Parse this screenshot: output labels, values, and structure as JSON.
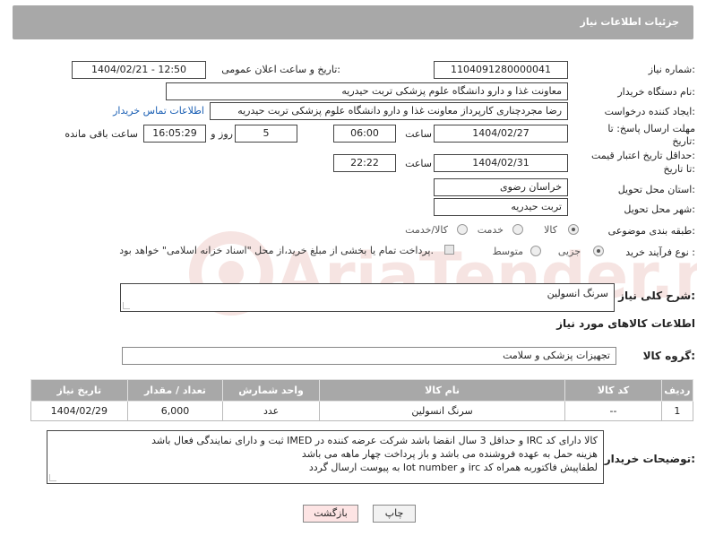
{
  "header": {
    "title": "جزئیات اطلاعات نیاز"
  },
  "form": {
    "need_number": {
      "label": "شماره نیاز:",
      "value": "1104091280000041"
    },
    "announce_datetime": {
      "label": "تاریخ و ساعت اعلان عمومی:",
      "value": "1404/02/21 - 12:50"
    },
    "buyer_org": {
      "label": "نام دستگاه خریدار:",
      "value": "معاونت غذا و دارو   دانشگاه علوم پزشکی تربت حیدریه"
    },
    "requester": {
      "label": "ایجاد کننده درخواست:",
      "value": "رضا مجردچناری کارپرداز معاونت غذا و دارو   دانشگاه علوم پزشکی تربت حیدریه",
      "contact_link": "اطلاعات تماس خریدار"
    },
    "reply_deadline": {
      "label_line1": "مهلت ارسال پاسخ: تا",
      "label_line2": "تاریخ:",
      "date": "1404/02/27",
      "time_label": "ساعت",
      "time": "06:00",
      "days": "5",
      "days_label": "روز و",
      "remaining": "16:05:29",
      "remaining_label": "ساعت باقی مانده"
    },
    "price_validity": {
      "label_line1": "حداقل تاریخ اعتبار قیمت:",
      "label_line2": "تا تاریخ:",
      "date": "1404/02/31",
      "time_label": "ساعت",
      "time": "22:22"
    },
    "delivery_province": {
      "label": "استان محل تحویل:",
      "value": "خراسان رضوی"
    },
    "delivery_city": {
      "label": "شهر محل تحویل:",
      "value": "تربت حیدریه"
    },
    "category": {
      "label": "طبقه بندی موضوعی:",
      "options": [
        "کالا",
        "خدمت",
        "کالا/خدمت"
      ],
      "selected": "کالا"
    },
    "purchase_process": {
      "label": "نوع فرآیند خرید :",
      "options": [
        "جزیی",
        "متوسط"
      ],
      "selected": "جزیی",
      "note": "پرداخت تمام یا بخشی از مبلغ خرید،از محل \"اسناد خزانه اسلامی\" خواهد بود."
    }
  },
  "summary": {
    "label": "شرح کلی نیاز:",
    "value": "سرنگ انسولین"
  },
  "goods_info": {
    "title": "اطلاعات کالاهای مورد نیاز"
  },
  "goods_group": {
    "label": "گروه کالا:",
    "value": "تجهیزات پزشکی و سلامت"
  },
  "table": {
    "headers": [
      "ردیف",
      "کد کالا",
      "نام کالا",
      "واحد شمارش",
      "تعداد / مقدار",
      "تاریخ نیاز"
    ],
    "rows": [
      {
        "row": "1",
        "code": "--",
        "name": "سرنگ انسولین",
        "unit": "عدد",
        "qty": "6,000",
        "date": "1404/02/29"
      }
    ]
  },
  "buyer_notes": {
    "label": "توضیحات خریدار:",
    "lines": [
      "کالا دارای کد IRC و حداقل 3 سال انقضا باشد شرکت عرضه کننده در IMED ثبت و دارای نمایندگی فعال باشد",
      "هزینه حمل به عهده فروشنده می باشد و باز پرداخت چهار ماهه می باشد",
      "لطفاپیش فاکتوربه همراه کد irc و lot number به پیوست ارسال گردد"
    ]
  },
  "buttons": {
    "print": "چاپ",
    "back": "بازگشت"
  },
  "watermark": {
    "text": "AriaTender.net",
    "color": "#c0392b"
  }
}
